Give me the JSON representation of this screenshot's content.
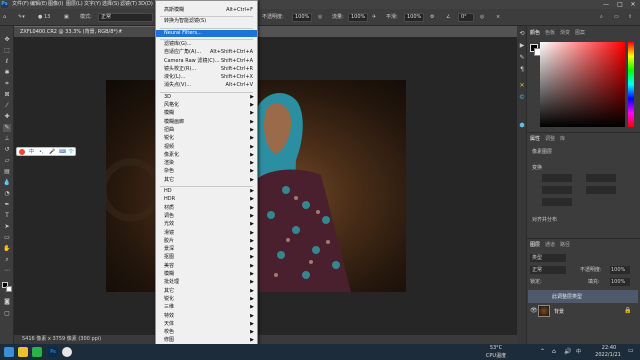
{
  "app": {
    "logo": "Ps"
  },
  "menubar": {
    "items": [
      "文件(F)",
      "编辑(E)",
      "图像(I)",
      "图层(L)",
      "文字(Y)",
      "选择(S)",
      "滤镜(T)",
      "3D(D)",
      "视图(V)",
      "增效工具",
      "窗口(W)",
      "帮助(H)"
    ]
  },
  "window_controls": {
    "minimize": "—",
    "maximize": "□",
    "close": "✕"
  },
  "options": {
    "mode_label": "模式:",
    "mode_value": "正常",
    "opacity_label": "不透明度:",
    "opacity_value": "100%",
    "flow_label": "流量:",
    "flow_value": "100%",
    "smooth_label": "平滑:",
    "smooth_value": "100%",
    "angle_value": "0°"
  },
  "document": {
    "tab": "ZXFL0400.CR2 @ 33.3% (背景, RGB/8*) *",
    "close": "×"
  },
  "statusbar": {
    "text": "5416 像素 x 3759 像素 (300 ppi)",
    "zoom": "33.33%"
  },
  "filter_menu": {
    "items": [
      {
        "label": "高斯模糊",
        "shortcut": "Alt+Ctrl+F",
        "sub": false,
        "hl": false
      },
      {
        "label": "转换为智能滤镜(S)",
        "shortcut": "",
        "sub": false,
        "hl": false
      },
      {
        "label": "Neural Filters...",
        "shortcut": "",
        "sub": false,
        "hl": true
      },
      {
        "label": "滤镜库(G)...",
        "shortcut": "",
        "sub": false,
        "hl": false
      },
      {
        "label": "自适应广角(A)...",
        "shortcut": "Alt+Shift+Ctrl+A",
        "sub": false,
        "hl": false
      },
      {
        "label": "Camera Raw 滤镜(C)...",
        "shortcut": "Shift+Ctrl+A",
        "sub": false,
        "hl": false
      },
      {
        "label": "镜头校正(R)...",
        "shortcut": "Shift+Ctrl+R",
        "sub": false,
        "hl": false
      },
      {
        "label": "液化(L)...",
        "shortcut": "Shift+Ctrl+X",
        "sub": false,
        "hl": false
      },
      {
        "label": "消失点(V)...",
        "shortcut": "Alt+Ctrl+V",
        "sub": false,
        "hl": false
      },
      {
        "label": "3D",
        "shortcut": "",
        "sub": true,
        "hl": false
      },
      {
        "label": "风格化",
        "shortcut": "",
        "sub": true,
        "hl": false
      },
      {
        "label": "模糊",
        "shortcut": "",
        "sub": true,
        "hl": false
      },
      {
        "label": "模糊画廊",
        "shortcut": "",
        "sub": true,
        "hl": false
      },
      {
        "label": "扭曲",
        "shortcut": "",
        "sub": true,
        "hl": false
      },
      {
        "label": "锐化",
        "shortcut": "",
        "sub": true,
        "hl": false
      },
      {
        "label": "视频",
        "shortcut": "",
        "sub": true,
        "hl": false
      },
      {
        "label": "像素化",
        "shortcut": "",
        "sub": true,
        "hl": false
      },
      {
        "label": "渲染",
        "shortcut": "",
        "sub": true,
        "hl": false
      },
      {
        "label": "杂色",
        "shortcut": "",
        "sub": true,
        "hl": false
      },
      {
        "label": "其它",
        "shortcut": "",
        "sub": true,
        "hl": false
      },
      {
        "label": "HD",
        "shortcut": "",
        "sub": true,
        "hl": false
      },
      {
        "label": "HDR",
        "shortcut": "",
        "sub": true,
        "hl": false
      },
      {
        "label": "材质",
        "shortcut": "",
        "sub": true,
        "hl": false
      },
      {
        "label": "调色",
        "shortcut": "",
        "sub": true,
        "hl": false
      },
      {
        "label": "光效",
        "shortcut": "",
        "sub": true,
        "hl": false
      },
      {
        "label": "滑镜",
        "shortcut": "",
        "sub": true,
        "hl": false
      },
      {
        "label": "胶片",
        "shortcut": "",
        "sub": true,
        "hl": false
      },
      {
        "label": "景深",
        "shortcut": "",
        "sub": true,
        "hl": false
      },
      {
        "label": "抠图",
        "shortcut": "",
        "sub": true,
        "hl": false
      },
      {
        "label": "美容",
        "shortcut": "",
        "sub": true,
        "hl": false
      },
      {
        "label": "模糊",
        "shortcut": "",
        "sub": true,
        "hl": false
      },
      {
        "label": "批处理",
        "shortcut": "",
        "sub": true,
        "hl": false
      },
      {
        "label": "其它",
        "shortcut": "",
        "sub": true,
        "hl": false
      },
      {
        "label": "锐化",
        "shortcut": "",
        "sub": true,
        "hl": false
      },
      {
        "label": "三维",
        "shortcut": "",
        "sub": true,
        "hl": false
      },
      {
        "label": "特效",
        "shortcut": "",
        "sub": true,
        "hl": false
      },
      {
        "label": "天体",
        "shortcut": "",
        "sub": true,
        "hl": false
      },
      {
        "label": "校色",
        "shortcut": "",
        "sub": true,
        "hl": false
      },
      {
        "label": "修图",
        "shortcut": "",
        "sub": true,
        "hl": false
      }
    ],
    "more": "⌄"
  },
  "panels": {
    "color_tabs": [
      "颜色",
      "色板",
      "渐变",
      "图案"
    ],
    "props_tabs": [
      "属性",
      "调整",
      "库"
    ],
    "props_title": "像素图层",
    "transform_label": "变换",
    "align_label": "对齐并分布",
    "layers_tabs": [
      "图层",
      "通道",
      "路径"
    ],
    "layer_kind": "类型",
    "blend_mode": "正常",
    "opacity_label": "不透明度:",
    "opacity_value": "100%",
    "lock_label": "锁定:",
    "fill_label": "填充:",
    "fill_value": "100%",
    "layer_effect_label": "此调整层类型",
    "background_layer": "背景"
  },
  "taskbar": {
    "temp": "53°C",
    "temp_label": "CPU温度",
    "time": "22:40",
    "date": "2022/1/21",
    "lang": "中"
  },
  "colors": {
    "accent": "#1e73d8",
    "ps_blue": "#31a8ff",
    "foreground": "#000000",
    "background": "#ffffff",
    "hue_red": "#ff0000"
  }
}
